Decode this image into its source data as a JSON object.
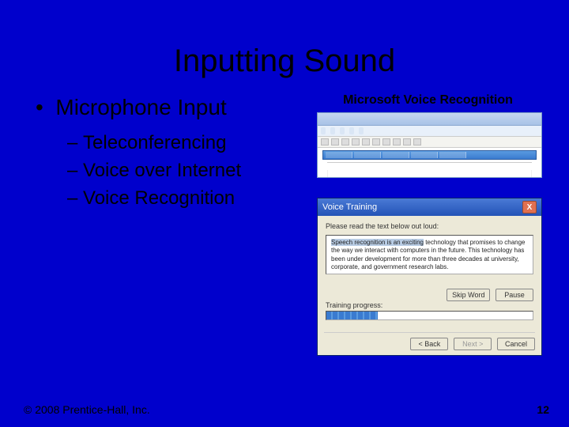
{
  "title": "Inputting Sound",
  "bullet": {
    "main": "Microphone Input"
  },
  "subbullets": {
    "a": "Teleconferencing",
    "b": "Voice over Internet",
    "c": "Voice Recognition"
  },
  "image_caption": "Microsoft Voice Recognition",
  "dialog": {
    "title": "Voice Training",
    "instruction": "Please read the text below out loud:",
    "highlight": "Speech recognition is an exciting",
    "body_rest": " technology that promises to change the way we interact with computers in the future. This technology has been under development for more than three decades at university, corporate, and government research labs.",
    "progress_label": "Training progress:",
    "skip": "Skip Word",
    "pause": "Pause",
    "back": "< Back",
    "next": "Next >",
    "cancel": "Cancel",
    "close_x": "X"
  },
  "footer": {
    "copyright": "© 2008 Prentice-Hall, Inc.",
    "page": "12"
  }
}
